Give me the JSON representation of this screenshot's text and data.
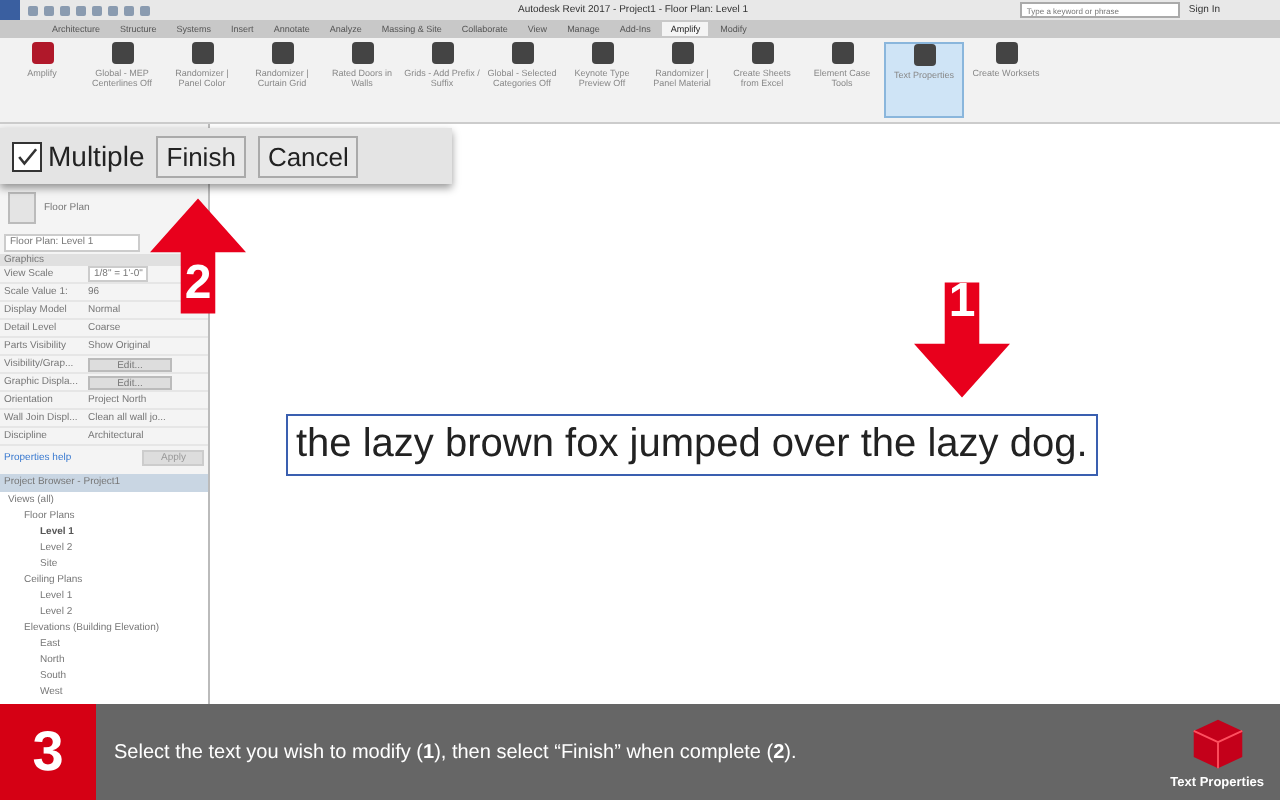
{
  "title_bar": {
    "title": "Autodesk Revit 2017 -    Project1 - Floor Plan: Level 1",
    "search": {
      "placeholder": "Type a keyword or phrase"
    },
    "sign_in": "Sign In"
  },
  "ribbon_tabs": [
    {
      "label": "Architecture",
      "selected": false
    },
    {
      "label": "Structure",
      "selected": false
    },
    {
      "label": "Systems",
      "selected": false
    },
    {
      "label": "Insert",
      "selected": false
    },
    {
      "label": "Annotate",
      "selected": false
    },
    {
      "label": "Analyze",
      "selected": false
    },
    {
      "label": "Massing & Site",
      "selected": false
    },
    {
      "label": "Collaborate",
      "selected": false
    },
    {
      "label": "View",
      "selected": false
    },
    {
      "label": "Manage",
      "selected": false
    },
    {
      "label": "Add-Ins",
      "selected": false
    },
    {
      "label": "Amplify",
      "selected": true
    },
    {
      "label": "Modify",
      "selected": false
    }
  ],
  "ribbon_buttons": [
    {
      "label": "Amplify",
      "selected": false
    },
    {
      "label": "Global - MEP Centerlines Off",
      "selected": false
    },
    {
      "label": "Randomizer | Panel Color",
      "selected": false
    },
    {
      "label": "Randomizer | Curtain Grid",
      "selected": false
    },
    {
      "label": "Rated Doors in Walls",
      "selected": false
    },
    {
      "label": "Grids - Add Prefix / Suffix",
      "selected": false
    },
    {
      "label": "Global - Selected Categories Off",
      "selected": false
    },
    {
      "label": "Keynote Type Preview Off",
      "selected": false
    },
    {
      "label": "Randomizer | Panel Material",
      "selected": false
    },
    {
      "label": "Create Sheets from Excel",
      "selected": false
    },
    {
      "label": "Element Case Tools",
      "selected": false
    },
    {
      "label": "Text Properties",
      "selected": true
    },
    {
      "label": "Create Worksets",
      "selected": false
    }
  ],
  "options_bar": {
    "multiple": {
      "label": "Multiple",
      "checked": true
    },
    "buttons": [
      "Finish",
      "Cancel"
    ]
  },
  "properties": {
    "type": "Floor Plan",
    "selector": "Floor Plan: Level 1",
    "section": "Graphics",
    "rows": [
      {
        "name": "View Scale",
        "value": "1/8\" = 1'-0\"",
        "kind": "field"
      },
      {
        "name": "Scale Value    1:",
        "value": "96",
        "kind": "text"
      },
      {
        "name": "Display Model",
        "value": "Normal",
        "kind": "text"
      },
      {
        "name": "Detail Level",
        "value": "Coarse",
        "kind": "text"
      },
      {
        "name": "Parts Visibility",
        "value": "Show Original",
        "kind": "text"
      },
      {
        "name": "Visibility/Grap...",
        "value": "Edit...",
        "kind": "button"
      },
      {
        "name": "Graphic Displa...",
        "value": "Edit...",
        "kind": "button"
      },
      {
        "name": "Orientation",
        "value": "Project North",
        "kind": "text"
      },
      {
        "name": "Wall Join Displ...",
        "value": "Clean all wall jo...",
        "kind": "text"
      },
      {
        "name": "Discipline",
        "value": "Architectural",
        "kind": "text"
      }
    ],
    "help": "Properties help",
    "apply": "Apply"
  },
  "project_browser": {
    "title": "Project Browser - Project1",
    "tree": [
      {
        "label": "Views (all)",
        "selected": false,
        "children": [
          {
            "label": "Floor Plans",
            "selected": false,
            "children": [
              {
                "label": "Level 1",
                "selected": true
              },
              {
                "label": "Level 2",
                "selected": false
              },
              {
                "label": "Site",
                "selected": false
              }
            ]
          },
          {
            "label": "Ceiling Plans",
            "selected": false,
            "children": [
              {
                "label": "Level 1",
                "selected": false
              },
              {
                "label": "Level 2",
                "selected": false
              }
            ]
          },
          {
            "label": "Elevations (Building Elevation)",
            "selected": false,
            "children": [
              {
                "label": "East",
                "selected": false
              },
              {
                "label": "North",
                "selected": false
              },
              {
                "label": "South",
                "selected": false
              },
              {
                "label": "West",
                "selected": false
              }
            ]
          }
        ]
      }
    ]
  },
  "canvas_text": "the lazy brown fox jumped over the lazy dog.",
  "callouts": [
    "1",
    "2"
  ],
  "caption": {
    "step": "3",
    "text": "Select the text you wish to modify (**1**), then select “Finish” when complete (**2**).",
    "badge": "Text Properties"
  }
}
